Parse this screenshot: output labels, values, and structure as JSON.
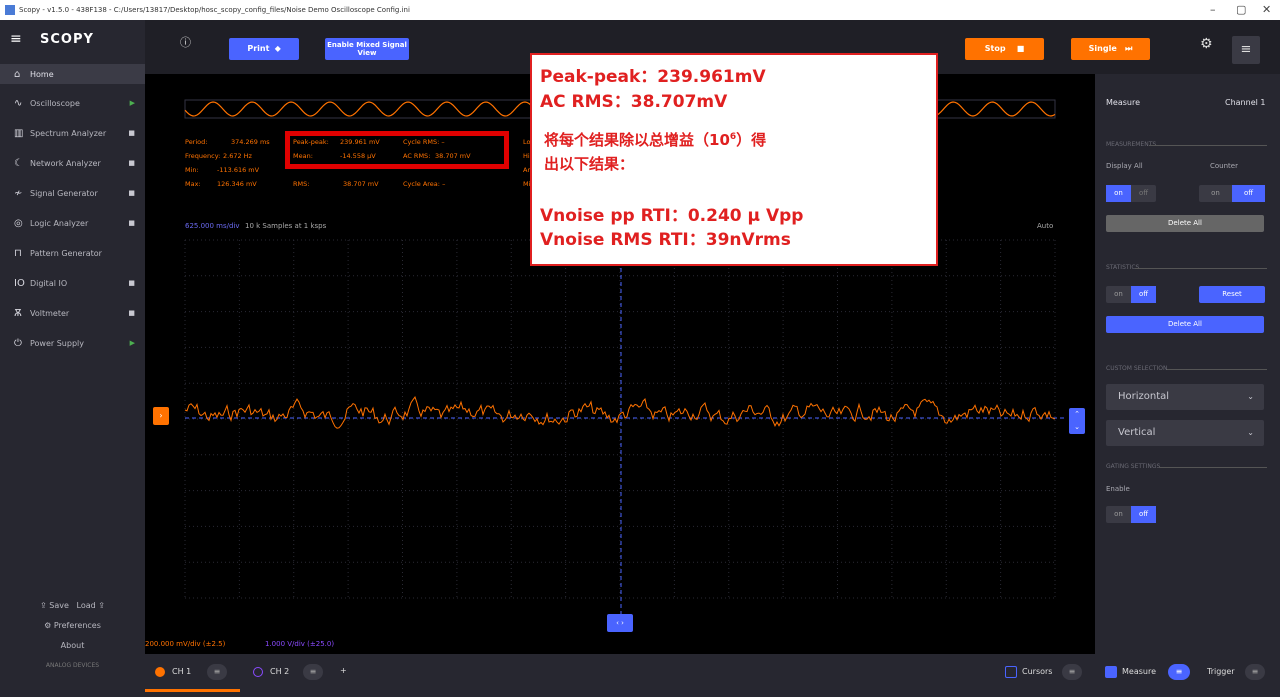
{
  "window": {
    "title": "Scopy - v1.5.0 - 438F138 - C:/Users/13817/Desktop/hosc_scopy_config_files/Noise Demo Oscilloscope Config.ini",
    "minimize": "–",
    "maximize": "▢",
    "close": "✕"
  },
  "sidebar": {
    "logo": "SCOPY",
    "items": [
      {
        "label": "Home",
        "icon": "home-icon"
      },
      {
        "label": "Oscilloscope",
        "status": "▶"
      },
      {
        "label": "Spectrum Analyzer",
        "status": "■"
      },
      {
        "label": "Network Analyzer",
        "status": "■"
      },
      {
        "label": "Signal Generator",
        "status": "■"
      },
      {
        "label": "Logic Analyzer",
        "status": "■"
      },
      {
        "label": "Pattern Generator",
        "status": ""
      },
      {
        "label": "Digital IO",
        "status": "■"
      },
      {
        "label": "Voltmeter",
        "status": "■"
      },
      {
        "label": "Power Supply",
        "status": "▶"
      }
    ],
    "save": "Save",
    "load": "Load",
    "preferences": "Preferences",
    "about": "About",
    "brand": "ANALOG DEVICES"
  },
  "toolbar": {
    "print": "Print",
    "mixed": "Enable Mixed Signal View",
    "stop": "Stop",
    "single": "Single"
  },
  "measurements": {
    "period_lbl": "Period:",
    "period": "374.269 ms",
    "freq_lbl": "Frequency:",
    "freq": "2.672 Hz",
    "min_lbl": "Min:",
    "min": "-113.616 mV",
    "max_lbl": "Max:",
    "max": "126.346 mV",
    "pp_lbl": "Peak-peak:",
    "pp": "239.961 mV",
    "mean_lbl": "Mean:",
    "mean": "-14.558 μV",
    "rms_lbl": "RMS:",
    "rms": "38.707 mV",
    "crms_lbl": "Cycle RMS:",
    "crms": "–",
    "acrms_lbl": "AC RMS:",
    "acrms": "38.707 mV",
    "carea_lbl": "Cycle Area:",
    "carea": "–",
    "low": "Low",
    "high": "High",
    "ampl": "Ampl",
    "mid": "Midd"
  },
  "plot": {
    "timebase": "625.000 ms/div",
    "samples": "10 k Samples at 1 ksps",
    "auto": "Auto",
    "ch1scale": "200.000 mV/div (±2.5)",
    "ch2scale": "1.000 V/div (±25.0)"
  },
  "right": {
    "title": "Measure",
    "channel": "Channel 1",
    "sec_meas": "MEASUREMENTS",
    "display_all": "Display All",
    "counter": "Counter",
    "on": "on",
    "off": "off",
    "delete_all": "Delete All",
    "sec_stats": "STATISTICS",
    "reset": "Reset",
    "sec_custom": "CUSTOM SELECTION",
    "horizontal": "Horizontal",
    "vertical": "Vertical",
    "sec_gating": "GATING SETTINGS",
    "enable": "Enable"
  },
  "bottom": {
    "ch1": "CH 1",
    "ch2": "CH 2",
    "plus": "+",
    "cursors": "Cursors",
    "measure": "Measure",
    "trigger": "Trigger"
  },
  "annotation": {
    "line1": "Peak-peak：239.961mV",
    "line2": "AC RMS：38.707mV",
    "line3": "将每个结果除以总增益（10",
    "sup": "6",
    "line3b": "）得",
    "line4": "出以下结果：",
    "line5": "Vnoise pp RTI：0.240 μ Vpp",
    "line6": "Vnoise RMS RTI：39nVrms"
  },
  "colors": {
    "accent": "#4a64ff",
    "orange": "#ff7200",
    "ch1": "#ff7200",
    "ch2": "#8a4bff",
    "annotation": "#e02020"
  }
}
